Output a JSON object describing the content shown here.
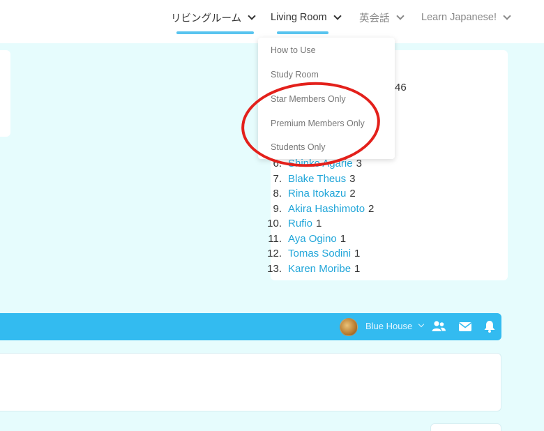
{
  "nav": {
    "items": [
      {
        "label": "リビングルーム"
      },
      {
        "label": "Living Room"
      },
      {
        "label": "英会話"
      },
      {
        "label": "Learn Japanese!"
      }
    ]
  },
  "dropdown": {
    "items": [
      {
        "label": "How to Use"
      },
      {
        "label": "Study Room"
      },
      {
        "label": "Star Members Only"
      },
      {
        "label": "Premium Members Only"
      },
      {
        "label": "Students Only"
      }
    ]
  },
  "ranking": {
    "partial_score": "46",
    "rows": [
      {
        "rank": "6.",
        "name": "Shinko Agarie",
        "score": "3"
      },
      {
        "rank": "7.",
        "name": "Blake Theus",
        "score": "3"
      },
      {
        "rank": "8.",
        "name": "Rina Itokazu",
        "score": "2"
      },
      {
        "rank": "9.",
        "name": "Akira Hashimoto",
        "score": "2"
      },
      {
        "rank": "10.",
        "name": "Rufio",
        "score": "1"
      },
      {
        "rank": "11.",
        "name": "Aya Ogino",
        "score": "1"
      },
      {
        "rank": "12.",
        "name": "Tomas Sodini",
        "score": "1"
      },
      {
        "rank": "13.",
        "name": "Karen Moribe",
        "score": "1"
      }
    ]
  },
  "user_bar": {
    "house_name": "Blue House",
    "icons": [
      "members-icon",
      "envelope-icon",
      "bell-icon"
    ]
  },
  "colors": {
    "accent": "#33bbf0",
    "link": "#22a6d9",
    "annotation": "#e3201b",
    "page_bg": "#e6fcfd"
  }
}
